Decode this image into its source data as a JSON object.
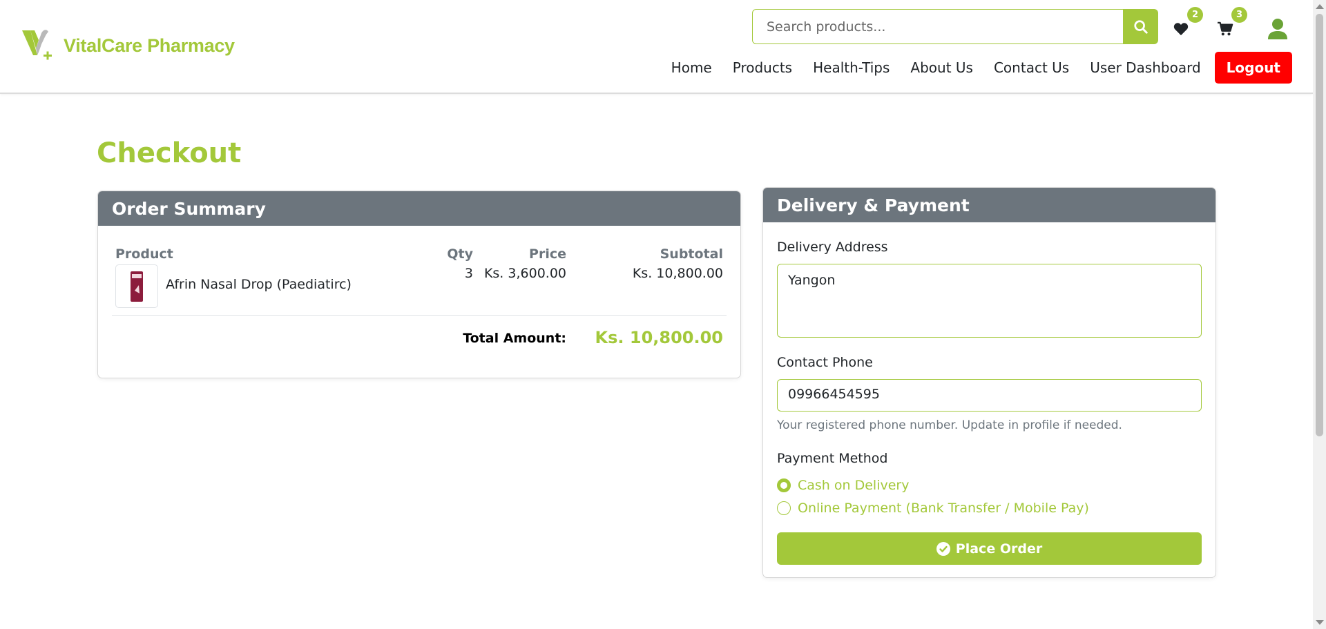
{
  "brand": {
    "name": "VitalCare Pharmacy",
    "color": "#a3c83a"
  },
  "search": {
    "placeholder": "Search products..."
  },
  "header_icons": {
    "wishlist": {
      "icon": "heart-icon",
      "count": "2"
    },
    "cart": {
      "icon": "cart-icon",
      "count": "3"
    },
    "user": {
      "icon": "user-icon"
    }
  },
  "nav": {
    "items": [
      "Home",
      "Products",
      "Health-Tips",
      "About Us",
      "Contact Us",
      "User Dashboard"
    ],
    "logout": "Logout",
    "logout_color": "#ff0000"
  },
  "page": {
    "title": "Checkout"
  },
  "order_summary": {
    "title": "Order Summary",
    "columns": {
      "product": "Product",
      "qty": "Qty",
      "price": "Price",
      "subtotal": "Subtotal"
    },
    "items": [
      {
        "name": "Afrin Nasal Drop (Paediatirc)",
        "qty": "3",
        "price": "Ks. 3,600.00",
        "subtotal": "Ks. 10,800.00"
      }
    ],
    "total_label": "Total Amount:",
    "total_value": "Ks. 10,800.00"
  },
  "delivery": {
    "title": "Delivery & Payment",
    "address_label": "Delivery Address",
    "address_value": "Yangon",
    "phone_label": "Contact Phone",
    "phone_value": "09966454595",
    "phone_hint": "Your registered phone number. Update in profile if needed.",
    "payment_label": "Payment Method",
    "payment_options": [
      {
        "label": "Cash on Delivery",
        "selected": true
      },
      {
        "label": "Online Payment (Bank Transfer / Mobile Pay)",
        "selected": false
      }
    ],
    "submit": "Place Order"
  }
}
